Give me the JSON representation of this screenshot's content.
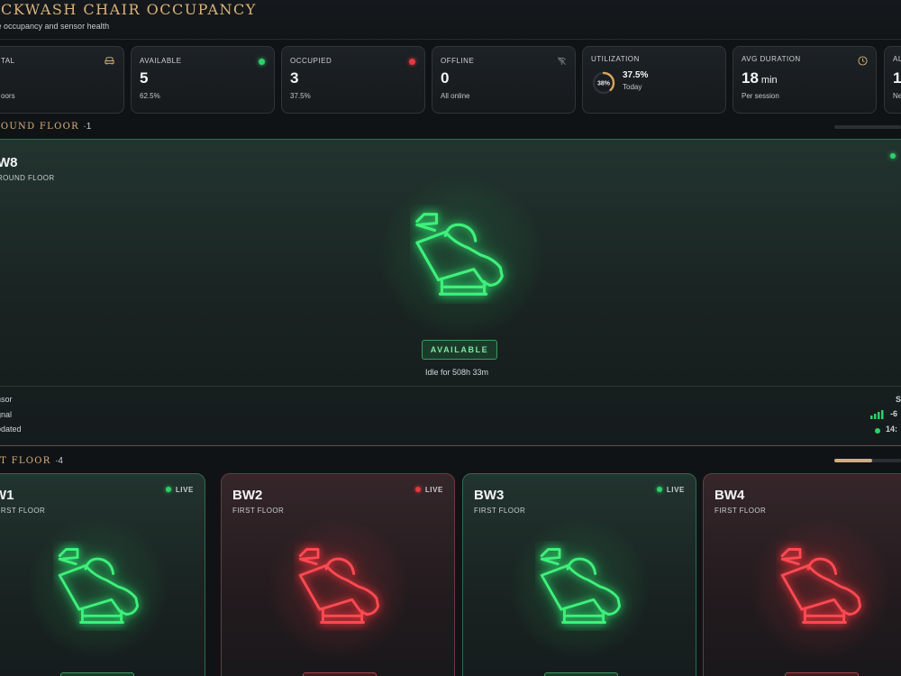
{
  "header": {
    "title": "ACKWASH CHAIR OCCUPANCY",
    "subtitle": "ve occupancy and sensor health"
  },
  "stats": {
    "total": {
      "label": "TAL",
      "sub": "oors",
      "icon": "chair-icon"
    },
    "available": {
      "label": "AVAILABLE",
      "value": "5",
      "sub": "62.5%",
      "dot_color": "#2ed06a"
    },
    "occupied": {
      "label": "OCCUPIED",
      "value": "3",
      "sub": "37.5%",
      "dot_color": "#e5383f"
    },
    "offline": {
      "label": "OFFLINE",
      "value": "0",
      "sub": "All online",
      "icon": "wifi-off-icon"
    },
    "utilization": {
      "label": "UTILIZATION",
      "ring_text": "38%",
      "value": "37.5%",
      "sub": "Today",
      "percent": 37.5
    },
    "avg_duration": {
      "label": "AVG DURATION",
      "value": "18",
      "unit": "min",
      "sub": "Per session",
      "icon": "clock-icon"
    },
    "partial": {
      "label": "AL",
      "value": "1",
      "sub": "Ne"
    }
  },
  "floors": {
    "ground": {
      "title": "ROUND FLOOR",
      "count": "·1",
      "scroll_fraction": 0.0,
      "featured": {
        "name": "W8",
        "floor": "ROUND FLOOR",
        "status": "AVAILABLE",
        "idle": "Idle for 508h 33m",
        "meta_labels": [
          "nsor",
          "gnal",
          "odated"
        ],
        "meta_values": [
          "S",
          "-6",
          "14:"
        ]
      }
    },
    "first": {
      "title": "ST FLOOR",
      "count": "·4",
      "scroll_fraction": 0.57,
      "cards": [
        {
          "name": "W1",
          "floor": "FIRST FLOOR",
          "live": "LIVE",
          "state": "green"
        },
        {
          "name": "BW2",
          "floor": "FIRST FLOOR",
          "live": "LIVE",
          "state": "red"
        },
        {
          "name": "BW3",
          "floor": "FIRST FLOOR",
          "live": "LIVE",
          "state": "green"
        },
        {
          "name": "BW4",
          "floor": "FIRST FLOOR",
          "live": "",
          "state": "red"
        }
      ]
    }
  },
  "colors": {
    "accent_gold": "#d9b27a",
    "available_green": "#2ed06a",
    "occupied_red": "#e5383f"
  }
}
